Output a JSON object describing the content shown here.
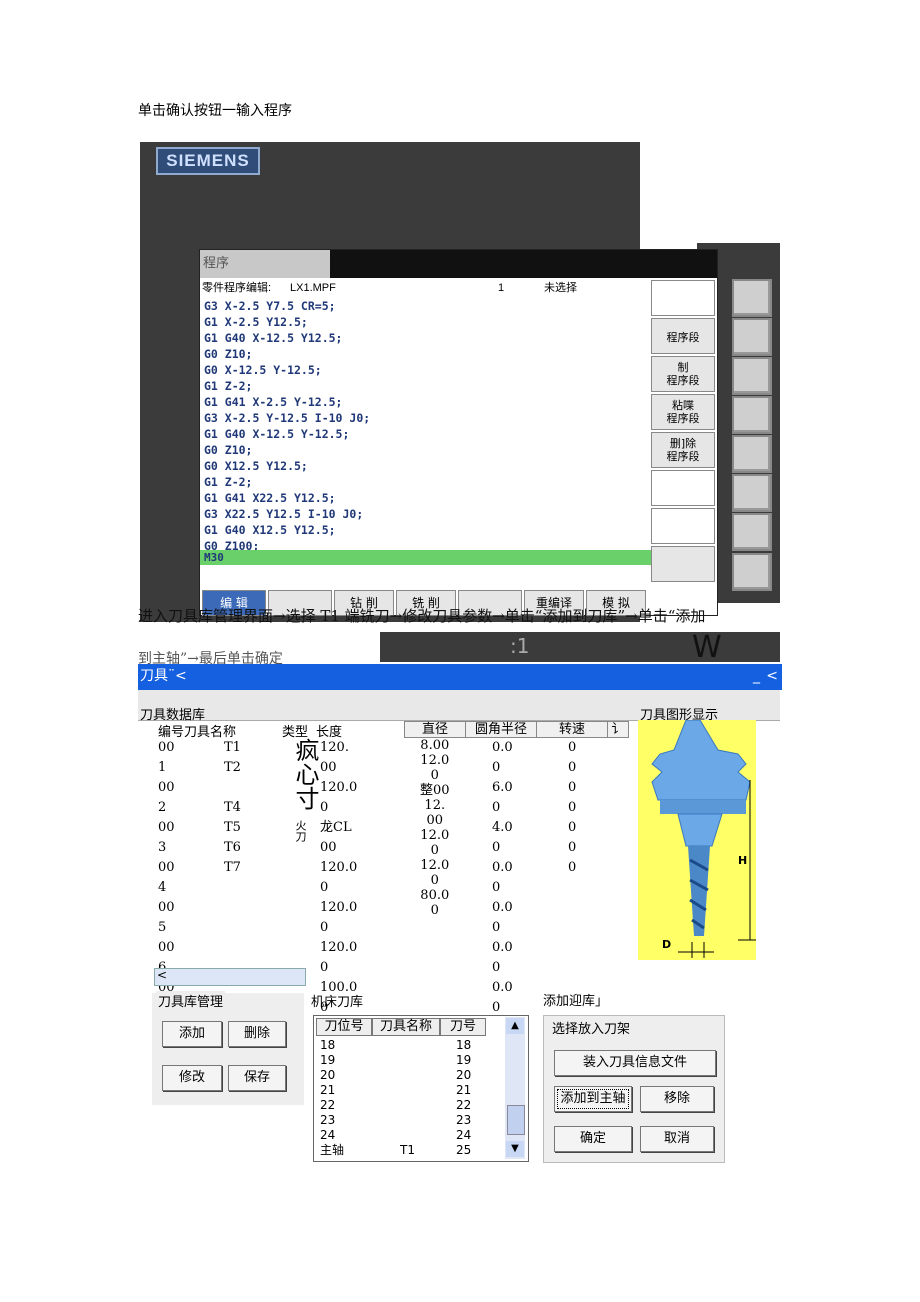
{
  "caption1": "单击确认按钮一输入程序",
  "cnc": {
    "brand": "SIEMENS",
    "screen_title": "程序",
    "info_label": "零件程序编辑:",
    "file": "LX1.MPF",
    "line_no": "1",
    "selection": "未选择",
    "code_lines": [
      "G3 X-2.5 Y7.5 CR=5;",
      "G1 X-2.5 Y12.5;",
      "G1 G40 X-12.5 Y12.5;",
      "G0 Z10;",
      "G0 X-12.5 Y-12.5;",
      "G1 Z-2;",
      "G1 G41 X-2.5 Y-12.5;",
      "G3 X-2.5 Y-12.5 I-10 J0;",
      "G1 G40 X-12.5 Y-12.5;",
      "G0 Z10;",
      "G0 X12.5 Y12.5;",
      "G1 Z-2;",
      "G1 G41 X22.5 Y12.5;",
      "G3 X22.5 Y12.5 I-10 J0;",
      "G1 G40 X12.5 Y12.5;",
      "G0 Z100;"
    ],
    "active_line": "M30",
    "vkeys": [
      "",
      "程序段",
      "制\n程序段",
      "粘喋\n程序段",
      "删]除\n程序段",
      "",
      "",
      ""
    ],
    "hkeys": [
      "编 辑",
      "",
      "钻 削",
      "铣 削",
      "",
      "重编译",
      "模 拟"
    ]
  },
  "caption2": "进入刀具库管理界面→选择 T1 端铣刀→修改刀具参数→单击“添加到刀库”→单击“添加",
  "caption2b": "到主轴”→最后单击确定",
  "overlay": {
    "ratio": ":1",
    "letter": "W"
  },
  "tool_window": {
    "title": "刀具¨<",
    "min": "_",
    "close": "<",
    "db_label": "刀具数据库",
    "graph_label": "刀具图形显示",
    "headers": [
      "编号刀具名称",
      "类型",
      "长度",
      "直径",
      "圆角半径",
      "转速",
      "讠"
    ],
    "col_no": "00\n1\n00\n2\n00\n3\n00\n4\n00\n5\n00\n6\n00",
    "col_name": "T1\nT2\n\nT4\nT5\nT6\nT7",
    "col_type": "疯心寸",
    "col_type_small": "火刀",
    "col_len": "120.\n00\n120.0\n0\n龙CL\n00\n120.0\n0\n120.0\n0\n120.0\n0\n100.0\n0",
    "col_dia": "8.00\n12.0\n0\n整00\n12.\n00\n12.0\n0\n12.0\n0\n80.0\n0",
    "col_rad": "0.0\n0\n6.0\n0\n4.0\n0\n0.0\n0\n0.0\n0\n0.0\n0\n0.0\n0",
    "col_speed": "0\n0\n0\n0\n0\n0\n0",
    "dim_h": "H",
    "dim_d": "D"
  },
  "mgmt": {
    "legend": "刀具库管理",
    "add": "添加",
    "delete": "删除",
    "modify": "修改",
    "save": "保存"
  },
  "machine_lib": {
    "label": "机床刀库",
    "headers": [
      "刀位号",
      "刀具名称",
      "刀号"
    ],
    "rows": [
      [
        "18",
        "",
        "18"
      ],
      [
        "19",
        "",
        "19"
      ],
      [
        "20",
        "",
        "20"
      ],
      [
        "21",
        "",
        "21"
      ],
      [
        "22",
        "",
        "22"
      ],
      [
        "23",
        "",
        "23"
      ],
      [
        "24",
        "",
        "24"
      ],
      [
        "主轴",
        "T1",
        "25"
      ]
    ]
  },
  "rack": {
    "add_label": "添加迎库」",
    "legend": "选择放入刀架",
    "load": "装入刀具信息文件",
    "add_spindle": "添加到主轴",
    "remove": "移除",
    "ok": "确定",
    "cancel": "取消"
  }
}
